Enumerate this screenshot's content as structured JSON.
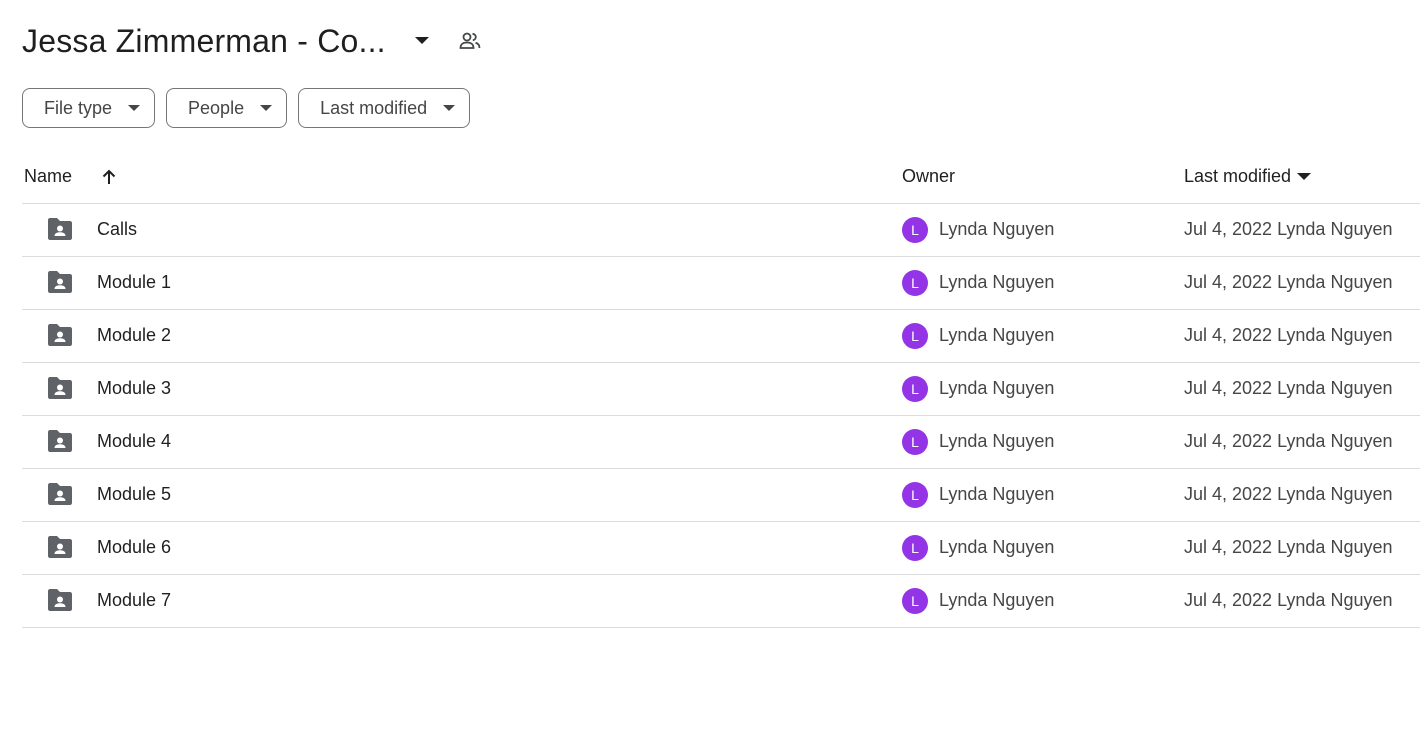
{
  "header": {
    "title": "Jessa Zimmerman - Co...",
    "dropdown_icon": "arrow-drop-down-icon",
    "shared_icon": "people-icon"
  },
  "filters": [
    {
      "label": "File type"
    },
    {
      "label": "People"
    },
    {
      "label": "Last modified"
    }
  ],
  "columns": {
    "name": "Name",
    "owner": "Owner",
    "last_modified": "Last modified"
  },
  "rows": [
    {
      "name": "Calls",
      "owner_initial": "L",
      "owner": "Lynda Nguyen",
      "modified": "Jul 4, 2022 Lynda Nguyen"
    },
    {
      "name": "Module 1",
      "owner_initial": "L",
      "owner": "Lynda Nguyen",
      "modified": "Jul 4, 2022 Lynda Nguyen"
    },
    {
      "name": "Module 2",
      "owner_initial": "L",
      "owner": "Lynda Nguyen",
      "modified": "Jul 4, 2022 Lynda Nguyen"
    },
    {
      "name": "Module 3",
      "owner_initial": "L",
      "owner": "Lynda Nguyen",
      "modified": "Jul 4, 2022 Lynda Nguyen"
    },
    {
      "name": "Module 4",
      "owner_initial": "L",
      "owner": "Lynda Nguyen",
      "modified": "Jul 4, 2022 Lynda Nguyen"
    },
    {
      "name": "Module 5",
      "owner_initial": "L",
      "owner": "Lynda Nguyen",
      "modified": "Jul 4, 2022 Lynda Nguyen"
    },
    {
      "name": "Module 6",
      "owner_initial": "L",
      "owner": "Lynda Nguyen",
      "modified": "Jul 4, 2022 Lynda Nguyen"
    },
    {
      "name": "Module 7",
      "owner_initial": "L",
      "owner": "Lynda Nguyen",
      "modified": "Jul 4, 2022 Lynda Nguyen"
    }
  ],
  "colors": {
    "avatar": "#9334e6",
    "folder_icon": "#5f6368",
    "divider": "#dadce0"
  }
}
